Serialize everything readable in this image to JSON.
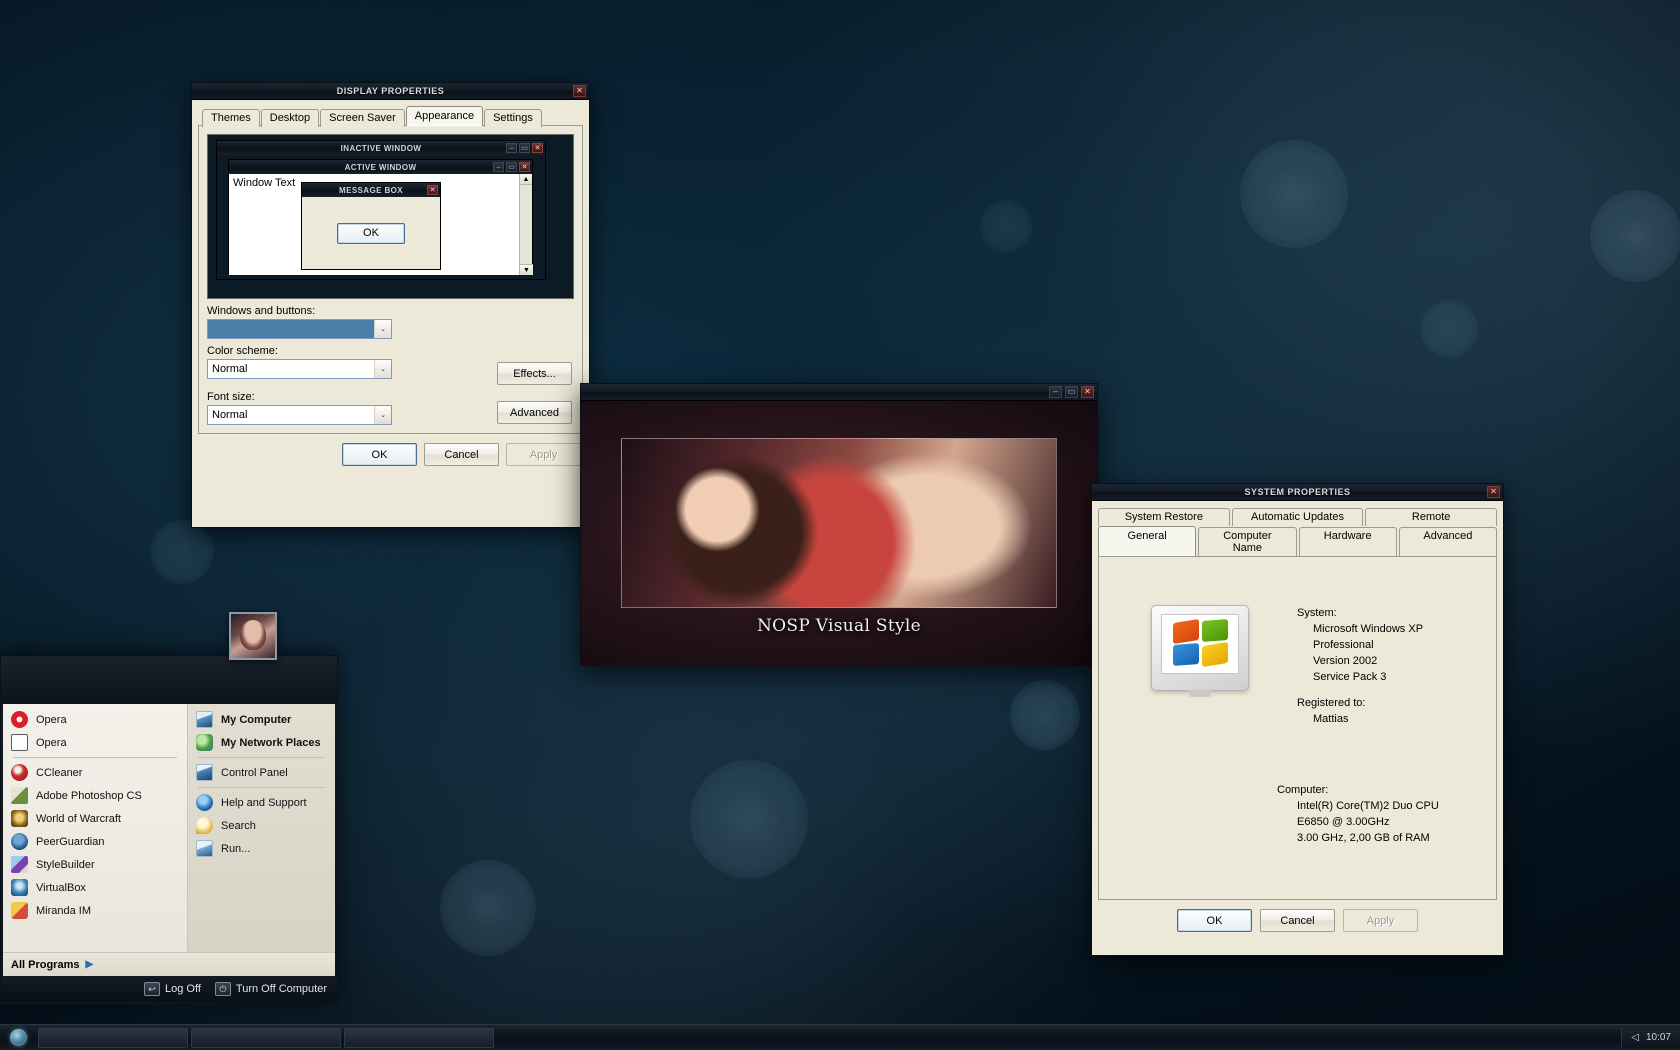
{
  "desktop": {
    "background_color": "#0c2b3e",
    "accent_color": "#4a7ea8"
  },
  "display_properties": {
    "title": "DISPLAY PROPERTIES",
    "close_label": "✕",
    "tabs": [
      {
        "label": "Themes",
        "selected": false
      },
      {
        "label": "Desktop",
        "selected": false
      },
      {
        "label": "Screen Saver",
        "selected": false
      },
      {
        "label": "Appearance",
        "selected": true
      },
      {
        "label": "Settings",
        "selected": false
      }
    ],
    "preview": {
      "inactive_window_title": "INACTIVE WINDOW",
      "active_window_title": "ACTIVE WINDOW",
      "window_text": "Window Text",
      "message_box_title": "MESSAGE BOX",
      "message_box_ok": "OK",
      "minimize_glyph": "–",
      "maximize_glyph": "▭",
      "close_glyph": "✕"
    },
    "windows_and_buttons_label": "Windows and buttons:",
    "windows_and_buttons_value": "",
    "color_scheme_label": "Color scheme:",
    "color_scheme_value": "Normal",
    "font_size_label": "Font size:",
    "font_size_value": "Normal",
    "effects_label": "Effects...",
    "advanced_label": "Advanced",
    "ok_label": "OK",
    "cancel_label": "Cancel",
    "apply_label": "Apply",
    "dropdown_arrow": "⌄"
  },
  "image_viewer": {
    "caption": "NOSP Visual Style",
    "minimize_glyph": "–",
    "maximize_glyph": "▭",
    "close_glyph": "✕"
  },
  "system_properties": {
    "title": "SYSTEM PROPERTIES",
    "close_label": "✕",
    "tabs_top": [
      {
        "label": "System Restore",
        "selected": false
      },
      {
        "label": "Automatic Updates",
        "selected": false
      },
      {
        "label": "Remote",
        "selected": false
      }
    ],
    "tabs_bottom": [
      {
        "label": "General",
        "selected": true
      },
      {
        "label": "Computer Name",
        "selected": false
      },
      {
        "label": "Hardware",
        "selected": false
      },
      {
        "label": "Advanced",
        "selected": false
      }
    ],
    "system_heading": "System:",
    "system_lines": [
      "Microsoft Windows XP",
      "Professional",
      "Version 2002",
      "Service Pack 3"
    ],
    "registered_heading": "Registered to:",
    "registered_lines": [
      "Mattias"
    ],
    "computer_heading": "Computer:",
    "computer_lines": [
      "Intel(R) Core(TM)2 Duo CPU",
      "E6850  @ 3.00GHz",
      "3.00 GHz, 2,00 GB of RAM"
    ],
    "ok_label": "OK",
    "cancel_label": "Cancel",
    "apply_label": "Apply"
  },
  "start_menu": {
    "left_items": [
      {
        "label": "Opera",
        "icon": "opera-icon",
        "bold": false,
        "separator_after": false
      },
      {
        "label": "Opera",
        "icon": "opera-mail-icon",
        "bold": false,
        "separator_after": true
      },
      {
        "label": "CCleaner",
        "icon": "ccleaner-icon",
        "bold": false,
        "separator_after": false
      },
      {
        "label": "Adobe Photoshop CS",
        "icon": "photoshop-icon",
        "bold": false,
        "separator_after": false
      },
      {
        "label": "World of Warcraft",
        "icon": "wow-icon",
        "bold": false,
        "separator_after": false
      },
      {
        "label": "PeerGuardian",
        "icon": "peerguardian-icon",
        "bold": false,
        "separator_after": false
      },
      {
        "label": "StyleBuilder",
        "icon": "stylebuilder-icon",
        "bold": false,
        "separator_after": false
      },
      {
        "label": "VirtualBox",
        "icon": "virtualbox-icon",
        "bold": false,
        "separator_after": false
      },
      {
        "label": "Miranda IM",
        "icon": "miranda-icon",
        "bold": false,
        "separator_after": false
      }
    ],
    "right_items": [
      {
        "label": "My Computer",
        "icon": "my-computer-icon",
        "bold": true,
        "separator_after": false
      },
      {
        "label": "My Network Places",
        "icon": "network-places-icon",
        "bold": true,
        "separator_after": true
      },
      {
        "label": "Control Panel",
        "icon": "control-panel-icon",
        "bold": false,
        "separator_after": true
      },
      {
        "label": "Help and Support",
        "icon": "help-icon",
        "bold": false,
        "separator_after": false
      },
      {
        "label": "Search",
        "icon": "search-icon",
        "bold": false,
        "separator_after": false
      },
      {
        "label": "Run...",
        "icon": "run-icon",
        "bold": false,
        "separator_after": false
      }
    ],
    "all_programs_label": "All Programs",
    "all_programs_arrow": "▶",
    "log_off_label": "Log Off",
    "log_off_glyph": "↩",
    "turn_off_label": "Turn Off Computer",
    "turn_off_glyph": "⏻"
  },
  "taskbar": {
    "start_orb": "start-orb",
    "clock": "10:07",
    "tray_icon": "volume-icon",
    "tray_glyph": "◁"
  }
}
